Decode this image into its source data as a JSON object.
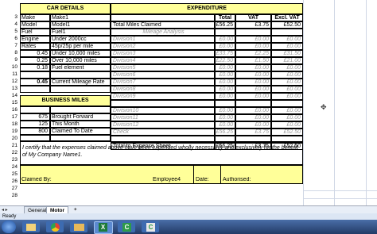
{
  "car_details": {
    "header": "CAR DETAILS",
    "rows": [
      {
        "label": "Make",
        "value": "Make1"
      },
      {
        "label": "Model",
        "value": "Model1"
      },
      {
        "label": "Fuel",
        "value": "Fuel1"
      },
      {
        "label": "Engine",
        "value": "Under 2000cc"
      },
      {
        "label": "Rates",
        "value": "45p/25p per mile"
      },
      {
        "label": "0.45",
        "value": "Under 10,000 miles"
      },
      {
        "label": "0.25",
        "value": "Over 10,000 miles"
      },
      {
        "label": "0.18",
        "value": "Fuel element"
      },
      {
        "label": "",
        "value": ""
      },
      {
        "label": "0.45",
        "value": "Current Mileage Rate"
      }
    ]
  },
  "business_miles": {
    "header": "BUSINESS MILES",
    "rows": [
      {
        "value": "675",
        "label": "Brought Forward"
      },
      {
        "value": "125",
        "label": "This Month"
      },
      {
        "value": "800",
        "label": "Claimed To Date"
      }
    ]
  },
  "expenditure": {
    "header": "EXPENDITURE",
    "col_total": "Total",
    "col_vat": "VAT",
    "col_excl": "Excl. VAT",
    "rows": [
      {
        "label": "Total Miles Claimed",
        "total": "£56.25",
        "vat": "£3.75",
        "excl": "£52.50",
        "style": "normal"
      },
      {
        "label": "Mileage Analysis",
        "total": "",
        "vat": "",
        "excl": "",
        "style": "sub"
      },
      {
        "label": "Division1",
        "total": "£0.00",
        "vat": "£0.00",
        "excl": "£0.00",
        "style": "grey"
      },
      {
        "label": "Division2",
        "total": "£0.00",
        "vat": "£0.00",
        "excl": "£0.00",
        "style": "grey"
      },
      {
        "label": "Division3",
        "total": "£33.75",
        "vat": "£2.25",
        "excl": "£31.50",
        "style": "grey"
      },
      {
        "label": "Division4",
        "total": "£22.50",
        "vat": "£1.50",
        "excl": "£21.00",
        "style": "grey"
      },
      {
        "label": "Division5",
        "total": "£0.00",
        "vat": "£0.00",
        "excl": "£0.00",
        "style": "grey"
      },
      {
        "label": "Division6",
        "total": "£0.00",
        "vat": "£0.00",
        "excl": "£0.00",
        "style": "grey"
      },
      {
        "label": "Division7",
        "total": "£0.00",
        "vat": "£0.00",
        "excl": "£0.00",
        "style": "grey"
      },
      {
        "label": "Division8",
        "total": "£0.00",
        "vat": "£0.00",
        "excl": "£0.00",
        "style": "grey"
      },
      {
        "label": "Division9",
        "total": "£0.00",
        "vat": "£0.00",
        "excl": "£0.00",
        "style": "grey"
      },
      {
        "label": "",
        "total": "",
        "vat": "",
        "excl": "",
        "style": "grey"
      },
      {
        "label": "Division10",
        "total": "£0.00",
        "vat": "£0.00",
        "excl": "£0.00",
        "style": "grey"
      },
      {
        "label": "Division11",
        "total": "£0.00",
        "vat": "£0.00",
        "excl": "£0.00",
        "style": "grey"
      },
      {
        "label": "Division12",
        "total": "£0.00",
        "vat": "£0.00",
        "excl": "£0.00",
        "style": "grey"
      },
      {
        "label": "Check",
        "total": "£56.25",
        "vat": "£3.75",
        "excl": "£52.50",
        "style": "grey"
      },
      {
        "label": "",
        "total": "",
        "vat": "",
        "excl": "",
        "style": "grey"
      },
      {
        "label": "Total to Expense Sheet",
        "total": "£56.25",
        "vat": "£3.75",
        "excl": "£52.50",
        "style": "normal"
      }
    ]
  },
  "certification": "I certify that the expenses claimed above have been expended wholly necessarily and exclusively for the benefit of My Company Name1.",
  "signoff": {
    "claimed_by": "Claimed By:",
    "employee": "Employee4",
    "date": "Date:",
    "authorised": "Authorised:"
  },
  "row_numbers": [
    "3",
    "4",
    "5",
    "6",
    "7",
    "8",
    "9",
    "10",
    "11",
    "12",
    "13",
    "14",
    "15",
    "16",
    "17",
    "18",
    "19",
    "20",
    "21",
    "22",
    "23",
    "24",
    "25",
    "26",
    "27",
    "28"
  ],
  "tabs": [
    "General",
    "Motor"
  ],
  "status": "Ready"
}
